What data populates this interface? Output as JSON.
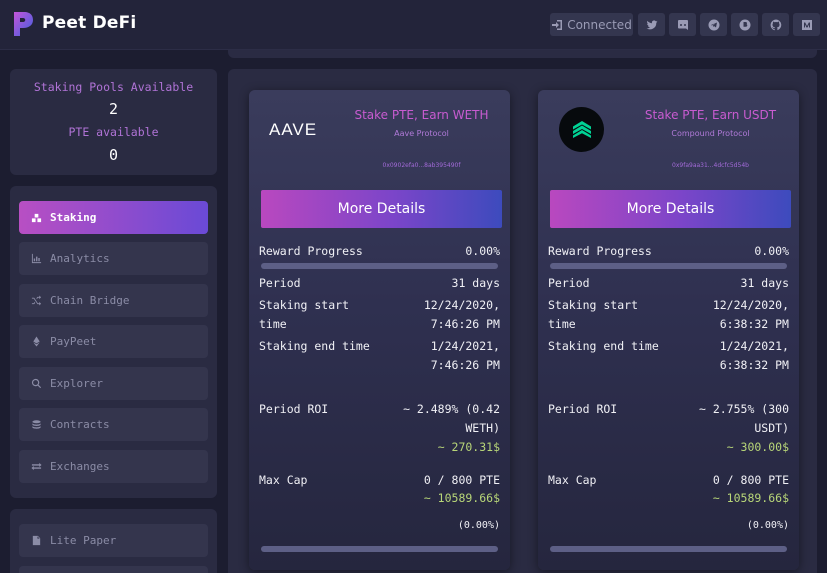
{
  "app": {
    "brand": "Peet DeFi",
    "header_buttons": [
      {
        "icon": "sign-in-icon",
        "label": "Connected"
      },
      {
        "icon": "twitter-icon",
        "label": ""
      },
      {
        "icon": "discord-icon",
        "label": ""
      },
      {
        "icon": "telegram-icon",
        "label": ""
      },
      {
        "icon": "bitcoin-icon",
        "label": ""
      },
      {
        "icon": "github-icon",
        "label": ""
      },
      {
        "icon": "medium-icon",
        "label": ""
      }
    ]
  },
  "sidebar": {
    "stats": {
      "pools_label": "Staking Pools Available",
      "pools_value": "2",
      "pte_label": "PTE available",
      "pte_value": "0"
    },
    "nav": [
      {
        "label": "Staking",
        "icon": "staking-icon",
        "active": true
      },
      {
        "label": "Analytics",
        "icon": "chart-icon",
        "active": false
      },
      {
        "label": "Chain Bridge",
        "icon": "shuffle-icon",
        "active": false
      },
      {
        "label": "PayPeet",
        "icon": "ethereum-icon",
        "active": false
      },
      {
        "label": "Explorer",
        "icon": "search-icon",
        "active": false
      },
      {
        "label": "Contracts",
        "icon": "coins-icon",
        "active": false
      },
      {
        "label": "Exchanges",
        "icon": "exchange-icon",
        "active": false
      }
    ],
    "nav2": [
      {
        "label": "Lite Paper",
        "icon": "document-icon"
      }
    ]
  },
  "pools": [
    {
      "logo": "AAVE",
      "title": "Stake PTE, Earn WETH",
      "protocol": "Aave Protocol",
      "address": "0x0902efa0...8ab395490f",
      "button": "More Details",
      "reward_label": "Reward Progress",
      "reward_value": "0.00%",
      "reward_progress": 0.0,
      "period_label": "Period",
      "period_value": "31 days",
      "start_label_1": "Staking start",
      "start_label_2": "time",
      "start_date": "12/24/2020,",
      "start_time": "7:46:26 PM",
      "end_label": "Staking end time",
      "end_date": "1/24/2021,",
      "end_time": "7:46:26 PM",
      "roi_label": "Period ROI",
      "roi_value_1": "~ 2.489% (0.42",
      "roi_value_2": "WETH)",
      "roi_usd": "~ 270.31$",
      "cap_label": "Max Cap",
      "cap_value": "0 / 800 PTE",
      "cap_usd": "~ 10589.66$",
      "cap_percent": "(0.00%)",
      "cap_progress": 0.0
    },
    {
      "logo": "compound-logo",
      "title": "Stake PTE, Earn USDT",
      "protocol": "Compound Protocol",
      "address": "0x9fa9aa31...4dcfc5d54b",
      "button": "More Details",
      "reward_label": "Reward Progress",
      "reward_value": "0.00%",
      "reward_progress": 0.0,
      "period_label": "Period",
      "period_value": "31 days",
      "start_label_1": "Staking start",
      "start_label_2": "time",
      "start_date": "12/24/2020,",
      "start_time": "6:38:32 PM",
      "end_label": "Staking end time",
      "end_date": "1/24/2021,",
      "end_time": "6:38:32 PM",
      "roi_label": "Period ROI",
      "roi_value_1": "~ 2.755% (300",
      "roi_value_2": "USDT)",
      "roi_usd": "~ 300.00$",
      "cap_label": "Max Cap",
      "cap_value": "0 / 800 PTE",
      "cap_usd": "~ 10589.66$",
      "cap_percent": "(0.00%)",
      "cap_progress": 0.0
    }
  ],
  "colors": {
    "accent_pink": "#c85bd0",
    "accent_blue": "#3d4bbd",
    "green_value": "#b8d678",
    "panel": "#2a2b42"
  }
}
